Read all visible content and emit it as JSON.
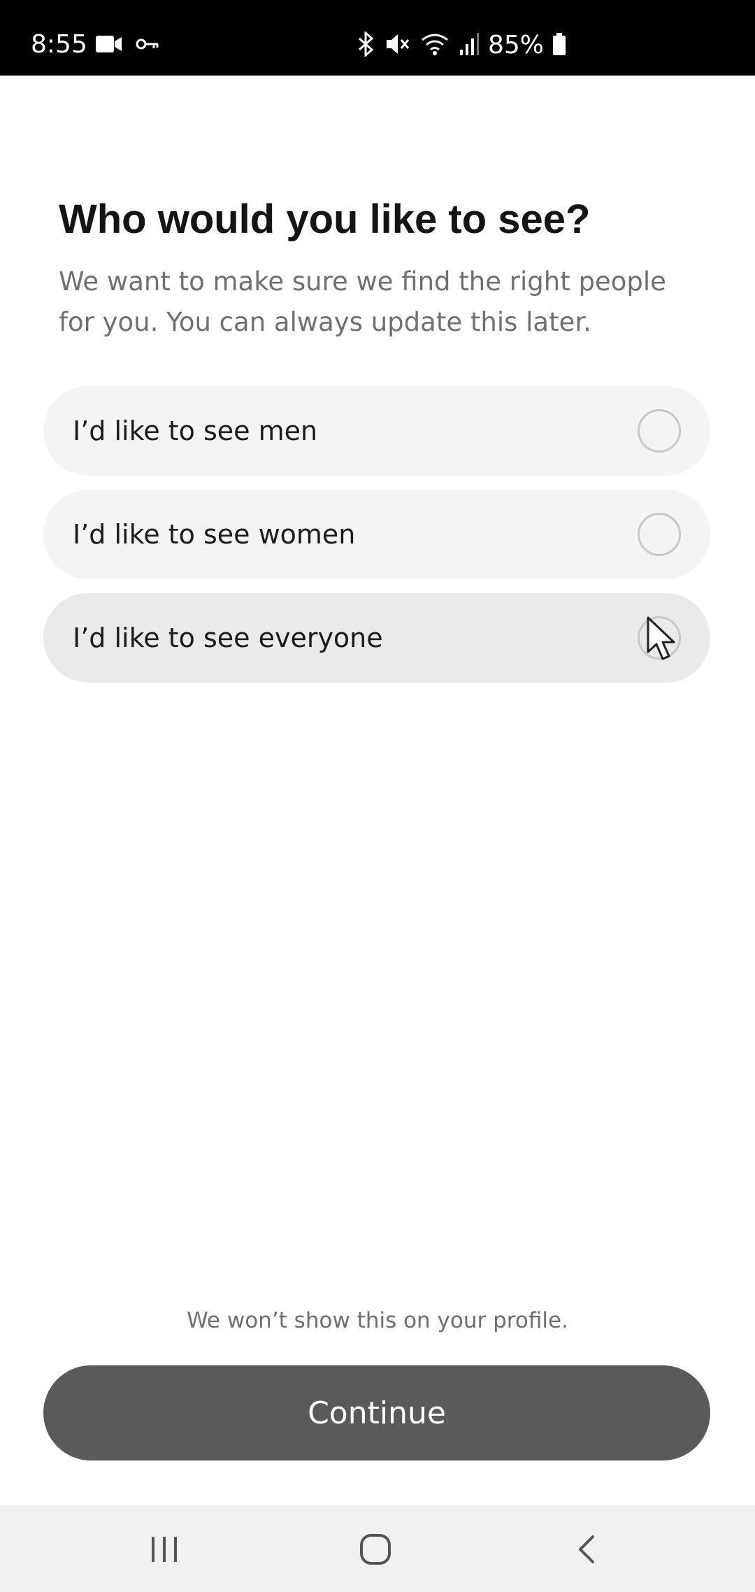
{
  "status_bar": {
    "time": "8:55",
    "battery": "85%",
    "left_icons": [
      "video-call-icon",
      "key-icon"
    ],
    "right_icons": [
      "bluetooth-icon",
      "mute-icon",
      "wifi-icon",
      "signal-icon",
      "battery-icon"
    ]
  },
  "page": {
    "title": "Who would you like to see?",
    "subtitle": "We want to make sure we find the right people for you. You can always update this later."
  },
  "options": [
    {
      "label": "I’d like to see men",
      "selected": false
    },
    {
      "label": "I’d like to see women",
      "selected": false
    },
    {
      "label": "I’d like to see everyone",
      "selected": false,
      "hovered": true
    }
  ],
  "footer": {
    "disclaimer": "We won’t show this on your profile.",
    "continue_label": "Continue"
  },
  "nav_bar": {
    "buttons": [
      "recents-icon",
      "home-icon",
      "back-icon"
    ]
  },
  "colors": {
    "accent_button": "#5a5a5a",
    "option_bg": "#f3f4f3",
    "status_bar_bg": "#000000"
  }
}
